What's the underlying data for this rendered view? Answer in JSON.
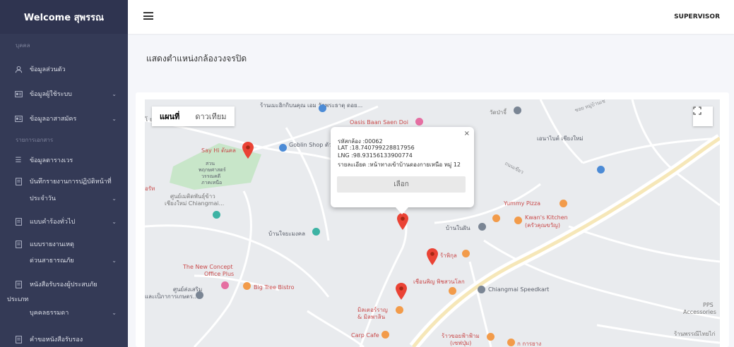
{
  "sidebar": {
    "title": "Welcome สุพรรณ",
    "section_personal": "บุคคล",
    "item_profile": "ข้อมูลส่วนตัว",
    "item_users": "ข้อมูลผู้ใช้ระบบ",
    "item_volunteers": "ข้อมูลอาสาสมัคร",
    "section_list": "รายการเอกสาร",
    "item_duty_table": "ข้อมูลตารางเวร",
    "item_daily_log_1": "บันทึกรายงานการปฏิบัติหน้าที่",
    "item_daily_log_2": "ประจำวัน",
    "item_general_request": "แบบคำร้องทั่วไป",
    "item_disaster_1": "แบบรายงานเหตุ",
    "item_disaster_2": "ด่วนสาธารณภัย",
    "item_cert_1": "หนังสือรับรองผู้ประสบภัย",
    "item_cert_2": "ประเภท",
    "item_cert_3": "บุคคลธรรมดา",
    "item_request_cert": "คำขอหนังสือรับรอง"
  },
  "topbar": {
    "role": "SUPERVISOR"
  },
  "page": {
    "title": "แสดงตำแหน่งกล้องวงจรปิด"
  },
  "map": {
    "type_map": "แผนที่",
    "type_satellite": "ดาวเทียม",
    "labels": {
      "cafe": "ร้านเมะฮิกกิบนคุณ เอม วัดพระธาตุ ดอย...",
      "oasis": "Oasis Baan Saen Doi",
      "wat": "วัดป่าจี้",
      "sayhi": "Say Hi ต้นคล",
      "goblin": "Goblin Shop ตัวแทนจำหน่าย",
      "park1": "สวน",
      "park2": "พฤกษศาสตร์",
      "park3": "วรรณคดี",
      "park4": "ภาคเหนือ",
      "center1": "ศูนย์เมติดพันธุ์ข้าว",
      "center2": "เชียงใหม่ Chiangmai...",
      "ernai": "เอนาไบต์ เชียงใหม่",
      "yummy": "Yummy Pizza",
      "kwans1": "Kwan's Kitchen",
      "kwans2": "(ครัวคุณขวัญ)",
      "baannai": "บ้านในฝัน",
      "baanjai": "บ้านใจยะมงคล",
      "rinpi": "ร้าพิกุล",
      "concept1": "The New Concept",
      "concept2": "Office Plus",
      "sorn1": "ศูนย์ส่งเสริม",
      "sorn2": "และเป็ภาการเกษตร...",
      "bigtree": "Big Tree Bistro",
      "pifin": "เชือนพิญ พิชสวนโลก",
      "speedkart": "Chiangmai Speedkart",
      "pps1": "PPS",
      "pps2": "Accessories",
      "mouthar1": "มิลเตอร์ราญ",
      "mouthar2": "& มิลพาลิน",
      "carp": "Carp Cafe",
      "bottom1": "ร้าวขอยฟ้าฟ้าม",
      "bottom2": "(เซฟปุ่ม)",
      "kangyang": "ก การยาง",
      "raanbottom": "ร้านพรรณีไทยไก่",
      "edge_left": "โ ยดี",
      "edge_left2": "อรัท",
      "road1": "ถนนเขียว",
      "road2": "ซอย หมู่บ้านเซ"
    },
    "info": {
      "code": "รหัสกล้อง :00062",
      "lat": "LAT :18.740799228817956",
      "lng": "LNG :98.93156133900774",
      "detail": "รายละเอียด :หน้าทางเข้าบ้านดองกายเหนือ หมู่ 12",
      "button": "เลือก",
      "close": "×"
    }
  }
}
